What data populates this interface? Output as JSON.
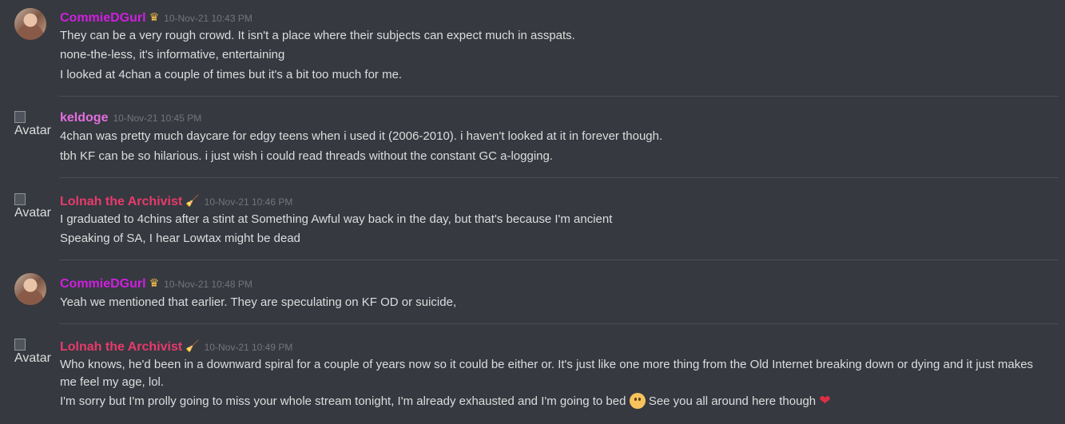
{
  "messages": [
    {
      "author": "CommieDGurl",
      "author_color": "#cf1fe0",
      "badge": "crown-icon",
      "timestamp": "10-Nov-21 10:43 PM",
      "avatar": "photo",
      "lines": [
        "They can be a very rough crowd. It isn't a place where their subjects can expect much in asspats.",
        "none-the-less, it's informative, entertaining",
        "I looked at 4chan a couple of times but it's a bit too much for me."
      ]
    },
    {
      "author": "keldoge",
      "author_color": "#e26ee0",
      "timestamp": "10-Nov-21 10:45 PM",
      "avatar": "broken",
      "avatar_alt": "Avatar",
      "lines": [
        "4chan was pretty much daycare for edgy teens when i used it (2006-2010). i haven't looked at it in forever though.",
        "tbh KF can be so hilarious. i just wish i could read threads without the constant GC a-logging."
      ]
    },
    {
      "author": "Lolnah the Archivist",
      "author_color": "#e83a6d",
      "badge": "broom-icon",
      "timestamp": "10-Nov-21 10:46 PM",
      "avatar": "broken",
      "avatar_alt": "Avatar",
      "lines": [
        "I graduated to 4chins after a stint at Something Awful way back in the day, but that's because I'm ancient",
        "Speaking of SA, I hear Lowtax might be dead"
      ]
    },
    {
      "author": "CommieDGurl",
      "author_color": "#cf1fe0",
      "badge": "crown-icon",
      "timestamp": "10-Nov-21 10:48 PM",
      "avatar": "photo",
      "lines": [
        "Yeah we mentioned that earlier. They are speculating on KF OD or suicide,"
      ]
    },
    {
      "author": "Lolnah the Archivist",
      "author_color": "#e83a6d",
      "badge": "broom-icon",
      "timestamp": "10-Nov-21 10:49 PM",
      "avatar": "broken",
      "avatar_alt": "Avatar",
      "lines": [
        "Who knows, he'd been in a downward spiral for a couple of years now so it could be either or. It's just like one more thing from the Old Internet breaking down or dying and it just makes",
        "me feel my age, lol.",
        "I'm sorry but I'm prolly going to miss your whole stream tonight, I'm already exhausted and I'm going to bed",
        "See you all around here though"
      ],
      "emoji": [
        "frowning-face-icon",
        "red-heart-icon"
      ]
    }
  ]
}
